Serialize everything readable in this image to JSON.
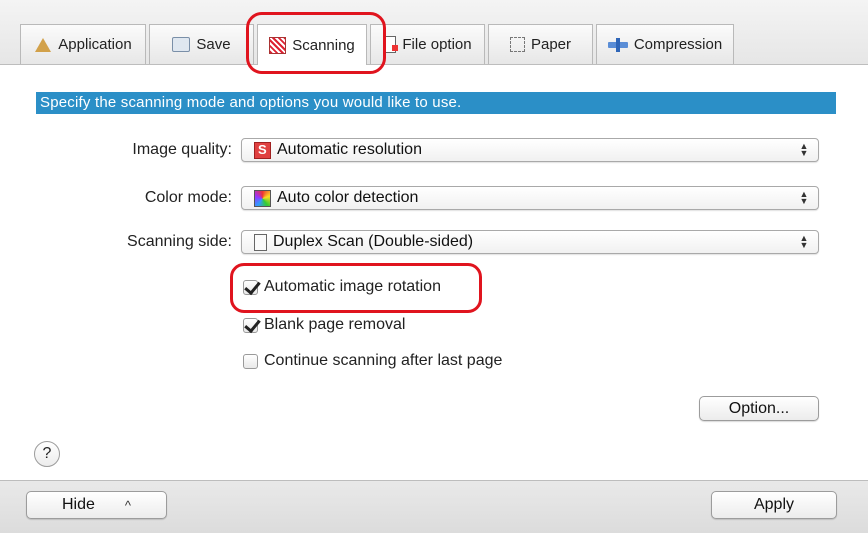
{
  "tabs": [
    {
      "label": "Application",
      "icon": "application-icon",
      "active": false
    },
    {
      "label": "Save",
      "icon": "save-icon",
      "active": false
    },
    {
      "label": "Scanning",
      "icon": "scanning-icon",
      "active": true
    },
    {
      "label": "File option",
      "icon": "file-option-icon",
      "active": false
    },
    {
      "label": "Paper",
      "icon": "paper-icon",
      "active": false
    },
    {
      "label": "Compression",
      "icon": "compression-icon",
      "active": false
    }
  ],
  "banner": {
    "text": "Specify the scanning mode and options you would like to use."
  },
  "form": {
    "image_quality": {
      "label": "Image quality:",
      "value": "Automatic resolution",
      "icon": "resolution-icon"
    },
    "color_mode": {
      "label": "Color mode:",
      "value": "Auto color detection",
      "icon": "color-icon"
    },
    "scanning_side": {
      "label": "Scanning side:",
      "value": "Duplex Scan (Double-sided)",
      "icon": "duplex-icon"
    }
  },
  "checkboxes": {
    "rotation": {
      "label": "Automatic image rotation",
      "checked": true
    },
    "blank_removal": {
      "label": "Blank page removal",
      "checked": true
    },
    "continue": {
      "label": "Continue scanning after last page",
      "checked": false
    }
  },
  "buttons": {
    "option": "Option...",
    "help": "?",
    "hide": "Hide",
    "hide_chevron": "^",
    "apply": "Apply"
  },
  "colors": {
    "banner": "#2b8fc7",
    "highlight": "#e0141e"
  }
}
